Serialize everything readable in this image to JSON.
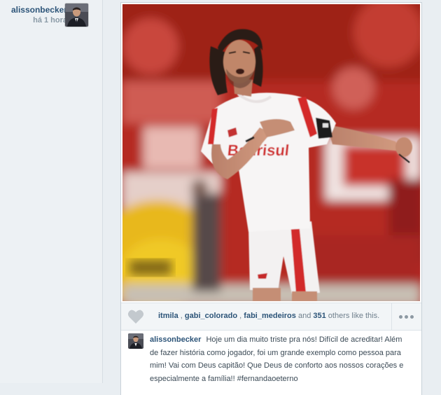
{
  "post": {
    "author": "alissonbecker",
    "time": "há 1 hora",
    "image_subject": "player-celebrating-photo",
    "likes": {
      "likers": [
        "itmila",
        "gabi_colorado",
        "fabi_medeiros"
      ],
      "sep1": ",",
      "sep2": ",",
      "and_word": "and",
      "others_count": "351",
      "others_suffix": "others like this."
    },
    "caption": {
      "user": "alissonbecker",
      "text": "Hoje um dia muito triste pra nós! Difícil de acreditar! Além de fazer história como jogador, foi um grande exemplo como pessoa para mim! Vai com Deus capitão! Que Deus de conforto aos nossos corações e especialmente a família!! #fernandaoeterno"
    },
    "jersey_text": "Banrisul",
    "icons": {
      "like": "heart-icon",
      "more": "ellipsis-icon"
    },
    "colors": {
      "username": "#2c5478",
      "meta": "#8a9aa6",
      "heart": "#c3c9ce"
    }
  }
}
